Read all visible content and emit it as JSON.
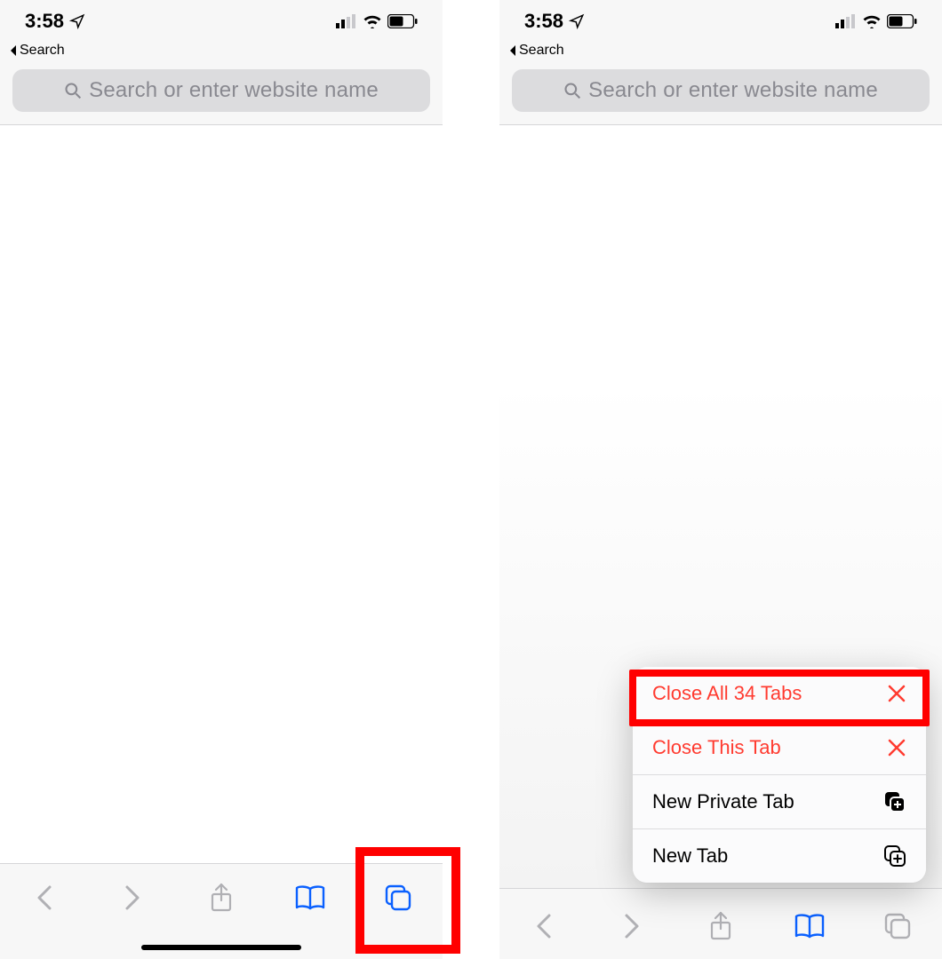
{
  "status": {
    "time": "3:58",
    "back_app_label": "Search"
  },
  "url_bar": {
    "placeholder": "Search or enter website name"
  },
  "menu": {
    "close_all_label": "Close All 34 Tabs",
    "close_this_label": "Close This Tab",
    "new_private_label": "New Private Tab",
    "new_tab_label": "New Tab"
  },
  "colors": {
    "accent_blue": "#0a60ff",
    "destructive_red": "#ff3b30",
    "toolbar_gray": "#b0b0b4"
  }
}
